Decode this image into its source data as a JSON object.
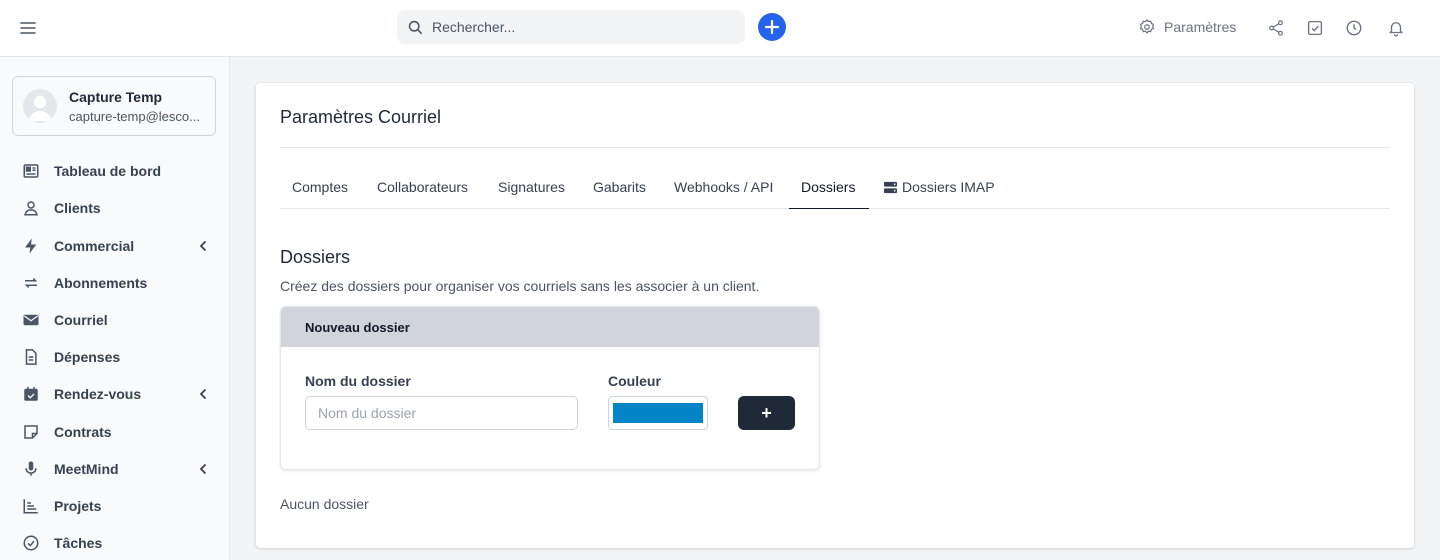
{
  "topbar": {
    "search_placeholder": "Rechercher...",
    "settings_label": "Paramètres",
    "icons": [
      "hamburger-icon",
      "search-icon",
      "plus-icon",
      "gear-icon",
      "share-icon",
      "checkbox-icon",
      "clock-icon",
      "bell-icon"
    ],
    "accent_color": "#2563eb"
  },
  "user": {
    "name": "Capture Temp",
    "email": "capture-temp@lesco..."
  },
  "sidebar": {
    "items": [
      {
        "label": "Tableau de bord",
        "icon": "dashboard-icon",
        "has_submenu": false
      },
      {
        "label": "Clients",
        "icon": "user-icon",
        "has_submenu": false
      },
      {
        "label": "Commercial",
        "icon": "lightning-icon",
        "has_submenu": true
      },
      {
        "label": "Abonnements",
        "icon": "repeat-icon",
        "has_submenu": false
      },
      {
        "label": "Courriel",
        "icon": "envelope-icon",
        "has_submenu": false
      },
      {
        "label": "Dépenses",
        "icon": "document-icon",
        "has_submenu": false
      },
      {
        "label": "Rendez-vous",
        "icon": "calendar-icon",
        "has_submenu": true
      },
      {
        "label": "Contrats",
        "icon": "note-icon",
        "has_submenu": false
      },
      {
        "label": "MeetMind",
        "icon": "microphone-icon",
        "has_submenu": true
      },
      {
        "label": "Projets",
        "icon": "chart-icon",
        "has_submenu": false
      },
      {
        "label": "Tâches",
        "icon": "check-circle-icon",
        "has_submenu": false
      }
    ]
  },
  "page": {
    "title": "Paramètres Courriel",
    "tabs": [
      {
        "label": "Comptes",
        "active": false
      },
      {
        "label": "Collaborateurs",
        "active": false
      },
      {
        "label": "Signatures",
        "active": false
      },
      {
        "label": "Gabarits",
        "active": false
      },
      {
        "label": "Webhooks / API",
        "active": false
      },
      {
        "label": "Dossiers",
        "active": true
      },
      {
        "label": "Dossiers IMAP",
        "active": false,
        "icon": "server-icon"
      }
    ]
  },
  "folders": {
    "title": "Dossiers",
    "description": "Créez des dossiers pour organiser vos courriels sans les associer à un client.",
    "new_folder": {
      "header": "Nouveau dossier",
      "name_label": "Nom du dossier",
      "name_placeholder": "Nom du dossier",
      "name_value": "",
      "color_label": "Couleur",
      "color_value": "#0284c7",
      "submit_label": "+"
    },
    "empty_text": "Aucun dossier"
  }
}
